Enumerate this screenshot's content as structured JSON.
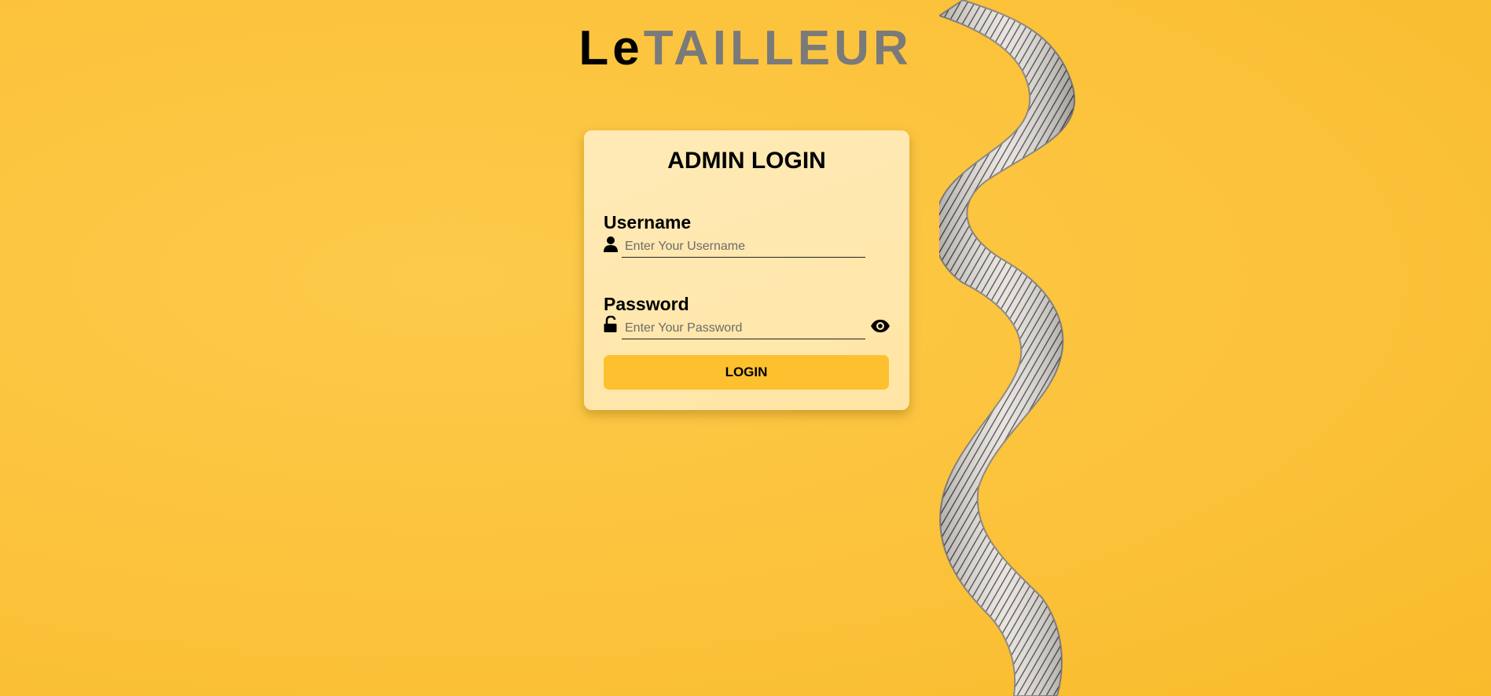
{
  "logo": {
    "part1": "Le",
    "part2": "TAILLEUR"
  },
  "login_form": {
    "title": "ADMIN LOGIN",
    "username": {
      "label": "Username",
      "placeholder": "Enter Your Username",
      "value": "",
      "icon": "user-icon"
    },
    "password": {
      "label": "Password",
      "placeholder": "Enter Your Password",
      "value": "",
      "icon": "unlock-icon",
      "toggle_icon": "eye-icon"
    },
    "submit_label": "LOGIN"
  },
  "colors": {
    "background": "#fcc43e",
    "card": "#ffe8ad",
    "button": "#fdc12f",
    "logo_secondary": "#7a7a7a"
  }
}
